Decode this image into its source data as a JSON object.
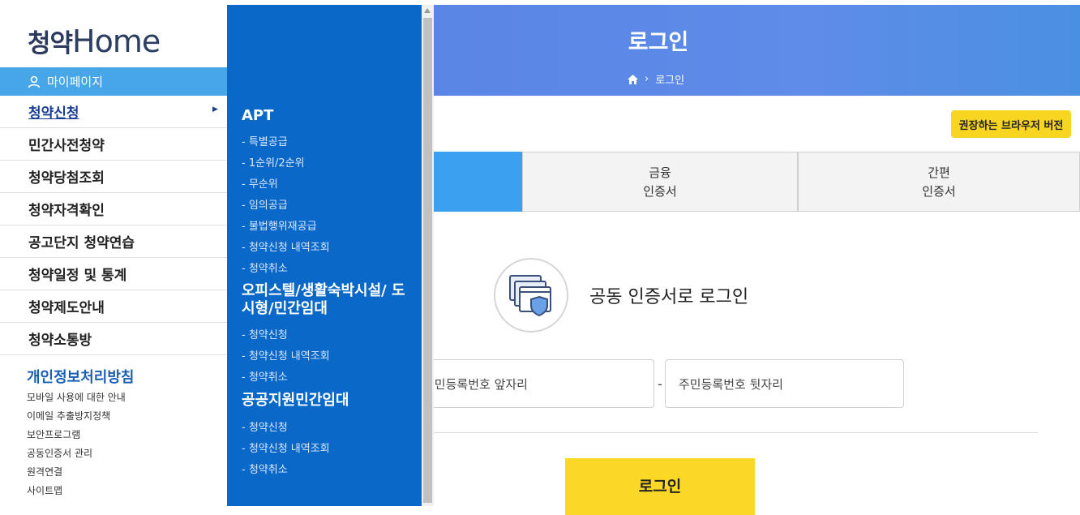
{
  "hero": {
    "title": "로그인",
    "breadcrumb": "로그인"
  },
  "browser_button": "권장하는 브라우저 버전",
  "tabs": [
    {
      "line1": "",
      "line2": ""
    },
    {
      "line1": "금융",
      "line2": "인증서"
    },
    {
      "line1": "간편",
      "line2": "인증서"
    }
  ],
  "cert": {
    "title": "공동 인증서로 로그인"
  },
  "fields": {
    "front_placeholder": "주민등록번호 앞자리",
    "separator": "-",
    "back_placeholder": "주민등록번호 뒷자리"
  },
  "login_button": "로그인",
  "sidebar": {
    "logo_korean": "청약",
    "logo_english": "Home",
    "mypage": "마이페이지",
    "items": [
      {
        "label": "청약신청"
      },
      {
        "label": "민간사전청약"
      },
      {
        "label": "청약당첨조회"
      },
      {
        "label": "청약자격확인"
      },
      {
        "label": "공고단지 청약연습"
      },
      {
        "label": "청약일정 및 통계"
      },
      {
        "label": "청약제도안내"
      },
      {
        "label": "청약소통방"
      }
    ],
    "privacy": "개인정보처리방침",
    "links": [
      "모바일 사용에 대한 안내",
      "이메일 추출방지정책",
      "보안프로그램",
      "공동인증서 관리",
      "원격연결",
      "사이트맵"
    ]
  },
  "submenu": {
    "groups": [
      {
        "title": "APT",
        "items": [
          "- 특별공급",
          "- 1순위/2순위",
          "- 무순위",
          "- 임의공급",
          "- 불법행위재공급",
          "- 청약신청 내역조회",
          "- 청약취소"
        ]
      },
      {
        "title": "오피스텔/생활숙박시설/ 도시형/민간임대",
        "items": [
          "- 청약신청",
          "- 청약신청 내역조회",
          "- 청약취소"
        ]
      },
      {
        "title": "공공지원민간임대",
        "items": [
          "- 청약신청",
          "- 청약신청 내역조회",
          "- 청약취소"
        ]
      }
    ]
  },
  "colors": {
    "hero": "#5a85e6",
    "submenu": "#0a68c8",
    "accent_yellow": "#fbd825",
    "mypage": "#46a6e8",
    "active_tab": "#3aa0ef"
  }
}
